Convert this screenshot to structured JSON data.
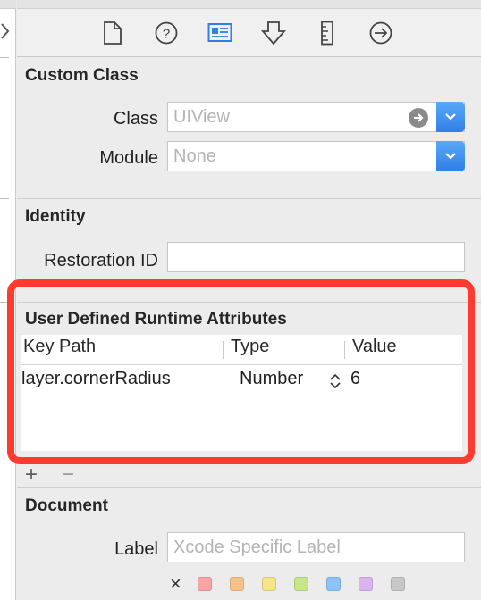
{
  "toolbar": {
    "icons": [
      "file-icon",
      "help-icon",
      "identity-icon",
      "attributes-icon",
      "size-icon",
      "connections-icon"
    ],
    "accent": "#2f7fe6"
  },
  "custom_class": {
    "title": "Custom Class",
    "class_label": "Class",
    "class_placeholder": "UIView",
    "module_label": "Module",
    "module_placeholder": "None"
  },
  "identity": {
    "title": "Identity",
    "restoration_label": "Restoration ID",
    "restoration_value": ""
  },
  "udra": {
    "title": "User Defined Runtime Attributes",
    "headers": [
      "Key Path",
      "Type",
      "Value"
    ],
    "rows": [
      {
        "key_path": "layer.cornerRadius",
        "type": "Number",
        "value": "6"
      }
    ],
    "add_label": "+",
    "remove_label": "−",
    "highlight_color": "#ff3b2f"
  },
  "document": {
    "title": "Document",
    "label_label": "Label",
    "label_placeholder": "Xcode Specific Label",
    "clear_label": "×",
    "colors": [
      "#f7a5a5",
      "#f7c28a",
      "#f4e58a",
      "#c9e58a",
      "#8ec3f5",
      "#d8b5f0",
      "#c8c8c8"
    ]
  }
}
